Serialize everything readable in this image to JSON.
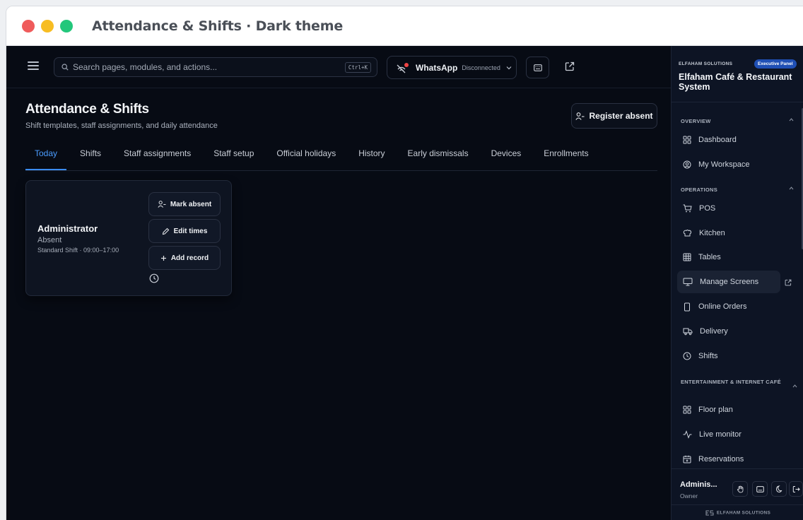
{
  "window": {
    "title": "Attendance & Shifts · Dark theme",
    "traffic_lights": [
      "#ef5b5b",
      "#f7bd22",
      "#23c77b"
    ]
  },
  "topbar": {
    "search_placeholder": "Search pages, modules, and actions...",
    "search_shortcut": "Ctrl+K",
    "whatsapp_label": "WhatsApp",
    "whatsapp_status": "Disconnected"
  },
  "header": {
    "title": "Attendance & Shifts",
    "subtitle": "Shift templates, staff assignments, and daily attendance",
    "register_absent_label": "Register absent"
  },
  "tabs": [
    {
      "label": "Today",
      "active": true
    },
    {
      "label": "Shifts",
      "active": false
    },
    {
      "label": "Staff assignments",
      "active": false
    },
    {
      "label": "Staff setup",
      "active": false
    },
    {
      "label": "Official holidays",
      "active": false
    },
    {
      "label": "History",
      "active": false
    },
    {
      "label": "Early dismissals",
      "active": false
    },
    {
      "label": "Devices",
      "active": false
    },
    {
      "label": "Enrollments",
      "active": false
    }
  ],
  "card": {
    "name": "Administrator",
    "status": "Absent",
    "shift": "Standard Shift · 09:00–17:00",
    "mark_absent_label": "Mark absent",
    "edit_times_label": "Edit times",
    "add_record_label": "Add record"
  },
  "sidebar": {
    "kicker": "ELFAHAM SOLUTIONS",
    "badge": "Executive Panel",
    "app_name": "Elfaham Café & Restaurant System",
    "sections": [
      {
        "title": "OVERVIEW",
        "items": [
          {
            "label": "Dashboard",
            "icon": "grid-icon"
          },
          {
            "label": "My Workspace",
            "icon": "user-circle-icon"
          }
        ]
      },
      {
        "title": "OPERATIONS",
        "items": [
          {
            "label": "POS",
            "icon": "cart-icon"
          },
          {
            "label": "Kitchen",
            "icon": "chef-hat-icon"
          },
          {
            "label": "Tables",
            "icon": "table-icon"
          },
          {
            "label": "Manage Screens",
            "icon": "monitor-icon",
            "active": true
          },
          {
            "label": "Online Orders",
            "icon": "phone-icon"
          },
          {
            "label": "Delivery",
            "icon": "truck-icon"
          },
          {
            "label": "Shifts",
            "icon": "clock-icon"
          }
        ]
      },
      {
        "title": "ENTERTAINMENT & INTERNET CAFÉ",
        "items": [
          {
            "label": "Floor plan",
            "icon": "grid-icon"
          },
          {
            "label": "Live monitor",
            "icon": "activity-icon"
          },
          {
            "label": "Reservations",
            "icon": "calendar-icon"
          }
        ]
      }
    ],
    "user_name": "Adminis...",
    "user_role": "Owner",
    "footer_brand": "ELFAHAM SOLUTIONS"
  },
  "colors": {
    "accent": "#3b8cf0",
    "background": "#070b14",
    "sidebar": "#0d1424",
    "badge": "#1f4fb5"
  }
}
